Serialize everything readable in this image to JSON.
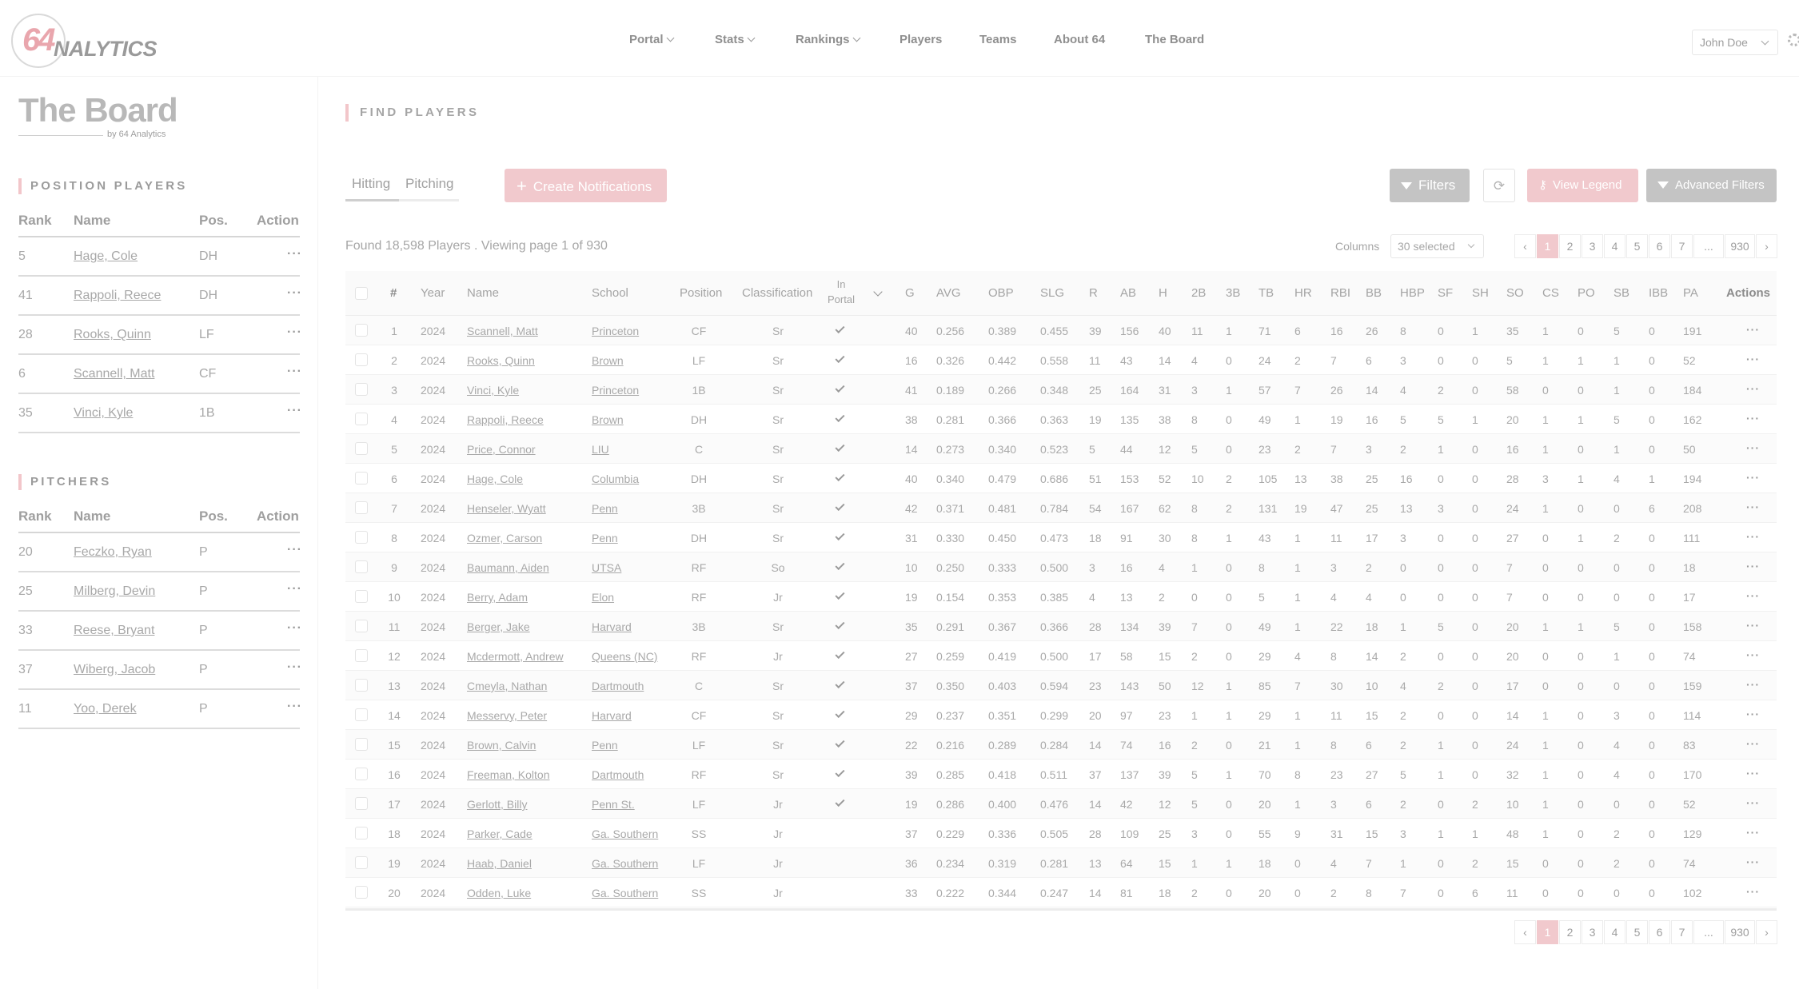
{
  "header": {
    "logo": {
      "num": "64",
      "word": "NALYTICS"
    },
    "nav": [
      {
        "label": "Portal",
        "dropdown": true
      },
      {
        "label": "Stats",
        "dropdown": true
      },
      {
        "label": "Rankings",
        "dropdown": true
      },
      {
        "label": "Players",
        "dropdown": false
      },
      {
        "label": "Teams",
        "dropdown": false
      },
      {
        "label": "About 64",
        "dropdown": false
      },
      {
        "label": "The Board",
        "dropdown": false
      }
    ],
    "user": "John Doe"
  },
  "sidebar": {
    "title": "The Board",
    "subtitle": "by 64 Analytics",
    "position_players": {
      "title": "POSITION PLAYERS",
      "headers": [
        "Rank",
        "Name",
        "Pos.",
        "Action"
      ],
      "rows": [
        {
          "rank": "5",
          "name": "Hage, Cole",
          "pos": "DH"
        },
        {
          "rank": "41",
          "name": "Rappoli, Reece",
          "pos": "DH"
        },
        {
          "rank": "28",
          "name": "Rooks, Quinn",
          "pos": "LF"
        },
        {
          "rank": "6",
          "name": "Scannell, Matt",
          "pos": "CF"
        },
        {
          "rank": "35",
          "name": "Vinci, Kyle",
          "pos": "1B"
        }
      ]
    },
    "pitchers": {
      "title": "PITCHERS",
      "headers": [
        "Rank",
        "Name",
        "Pos.",
        "Action"
      ],
      "rows": [
        {
          "rank": "20",
          "name": "Feczko, Ryan",
          "pos": "P"
        },
        {
          "rank": "25",
          "name": "Milberg, Devin",
          "pos": "P"
        },
        {
          "rank": "33",
          "name": "Reese, Bryant",
          "pos": "P"
        },
        {
          "rank": "37",
          "name": "Wiberg, Jacob",
          "pos": "P"
        },
        {
          "rank": "11",
          "name": "Yoo, Derek",
          "pos": "P"
        }
      ]
    }
  },
  "main": {
    "title": "FIND PLAYERS",
    "tabs": [
      "Hitting",
      "Pitching"
    ],
    "active_tab": "Hitting",
    "buttons": {
      "create": "Create Notifications",
      "filters": "Filters",
      "legend": "View Legend",
      "advanced": "Advanced Filters"
    },
    "found_text": "Found 18,598 Players . Viewing page 1 of 930",
    "columns_label": "Columns",
    "columns_value": "30 selected",
    "pagination": {
      "pages": [
        "1",
        "2",
        "3",
        "4",
        "5",
        "6",
        "7",
        "...",
        "930"
      ],
      "active": "1"
    },
    "table": {
      "headers": [
        "#",
        "Year",
        "Name",
        "School",
        "Position",
        "Classification",
        "In Portal",
        "G",
        "AVG",
        "OBP",
        "SLG",
        "R",
        "AB",
        "H",
        "2B",
        "3B",
        "TB",
        "HR",
        "RBI",
        "BB",
        "HBP",
        "SF",
        "SH",
        "SO",
        "CS",
        "PO",
        "SB",
        "IBB",
        "PA",
        "Actions"
      ],
      "rows": [
        [
          "1",
          "2024",
          "Scannell, Matt",
          "Princeton",
          "CF",
          "Sr",
          true,
          "40",
          "0.256",
          "0.389",
          "0.455",
          "39",
          "156",
          "40",
          "11",
          "1",
          "71",
          "6",
          "16",
          "26",
          "8",
          "0",
          "1",
          "35",
          "1",
          "0",
          "5",
          "0",
          "191"
        ],
        [
          "2",
          "2024",
          "Rooks, Quinn",
          "Brown",
          "LF",
          "Sr",
          true,
          "16",
          "0.326",
          "0.442",
          "0.558",
          "11",
          "43",
          "14",
          "4",
          "0",
          "24",
          "2",
          "7",
          "6",
          "3",
          "0",
          "0",
          "5",
          "1",
          "1",
          "1",
          "0",
          "52"
        ],
        [
          "3",
          "2024",
          "Vinci, Kyle",
          "Princeton",
          "1B",
          "Sr",
          true,
          "41",
          "0.189",
          "0.266",
          "0.348",
          "25",
          "164",
          "31",
          "3",
          "1",
          "57",
          "7",
          "26",
          "14",
          "4",
          "2",
          "0",
          "58",
          "0",
          "0",
          "1",
          "0",
          "184"
        ],
        [
          "4",
          "2024",
          "Rappoli, Reece",
          "Brown",
          "DH",
          "Sr",
          true,
          "38",
          "0.281",
          "0.366",
          "0.363",
          "19",
          "135",
          "38",
          "8",
          "0",
          "49",
          "1",
          "19",
          "16",
          "5",
          "5",
          "1",
          "20",
          "1",
          "1",
          "5",
          "0",
          "162"
        ],
        [
          "5",
          "2024",
          "Price, Connor",
          "LIU",
          "C",
          "Sr",
          true,
          "14",
          "0.273",
          "0.340",
          "0.523",
          "5",
          "44",
          "12",
          "5",
          "0",
          "23",
          "2",
          "7",
          "3",
          "2",
          "1",
          "0",
          "16",
          "1",
          "0",
          "1",
          "0",
          "50"
        ],
        [
          "6",
          "2024",
          "Hage, Cole",
          "Columbia",
          "DH",
          "Sr",
          true,
          "40",
          "0.340",
          "0.479",
          "0.686",
          "51",
          "153",
          "52",
          "10",
          "2",
          "105",
          "13",
          "38",
          "25",
          "16",
          "0",
          "0",
          "28",
          "3",
          "1",
          "4",
          "1",
          "194"
        ],
        [
          "7",
          "2024",
          "Henseler, Wyatt",
          "Penn",
          "3B",
          "Sr",
          true,
          "42",
          "0.371",
          "0.481",
          "0.784",
          "54",
          "167",
          "62",
          "8",
          "2",
          "131",
          "19",
          "47",
          "25",
          "13",
          "3",
          "0",
          "24",
          "1",
          "0",
          "0",
          "6",
          "208"
        ],
        [
          "8",
          "2024",
          "Ozmer, Carson",
          "Penn",
          "DH",
          "Sr",
          true,
          "31",
          "0.330",
          "0.450",
          "0.473",
          "18",
          "91",
          "30",
          "8",
          "1",
          "43",
          "1",
          "11",
          "17",
          "3",
          "0",
          "0",
          "27",
          "0",
          "1",
          "2",
          "0",
          "111"
        ],
        [
          "9",
          "2024",
          "Baumann, Aiden",
          "UTSA",
          "RF",
          "So",
          true,
          "10",
          "0.250",
          "0.333",
          "0.500",
          "3",
          "16",
          "4",
          "1",
          "0",
          "8",
          "1",
          "3",
          "2",
          "0",
          "0",
          "0",
          "7",
          "0",
          "0",
          "0",
          "0",
          "18"
        ],
        [
          "10",
          "2024",
          "Berry, Adam",
          "Elon",
          "RF",
          "Jr",
          true,
          "19",
          "0.154",
          "0.353",
          "0.385",
          "4",
          "13",
          "2",
          "0",
          "0",
          "5",
          "1",
          "4",
          "4",
          "0",
          "0",
          "0",
          "7",
          "0",
          "0",
          "0",
          "0",
          "17"
        ],
        [
          "11",
          "2024",
          "Berger, Jake",
          "Harvard",
          "3B",
          "Sr",
          true,
          "35",
          "0.291",
          "0.367",
          "0.366",
          "28",
          "134",
          "39",
          "7",
          "0",
          "49",
          "1",
          "22",
          "18",
          "1",
          "5",
          "0",
          "20",
          "1",
          "1",
          "5",
          "0",
          "158"
        ],
        [
          "12",
          "2024",
          "Mcdermott, Andrew",
          "Queens (NC)",
          "RF",
          "Jr",
          true,
          "27",
          "0.259",
          "0.419",
          "0.500",
          "17",
          "58",
          "15",
          "2",
          "0",
          "29",
          "4",
          "8",
          "14",
          "2",
          "0",
          "0",
          "20",
          "0",
          "0",
          "1",
          "0",
          "74"
        ],
        [
          "13",
          "2024",
          "Cmeyla, Nathan",
          "Dartmouth",
          "C",
          "Sr",
          true,
          "37",
          "0.350",
          "0.403",
          "0.594",
          "23",
          "143",
          "50",
          "12",
          "1",
          "85",
          "7",
          "30",
          "10",
          "4",
          "2",
          "0",
          "17",
          "0",
          "0",
          "0",
          "0",
          "159"
        ],
        [
          "14",
          "2024",
          "Messervy, Peter",
          "Harvard",
          "CF",
          "Sr",
          true,
          "29",
          "0.237",
          "0.351",
          "0.299",
          "20",
          "97",
          "23",
          "1",
          "1",
          "29",
          "1",
          "11",
          "15",
          "2",
          "0",
          "0",
          "14",
          "1",
          "0",
          "3",
          "0",
          "114"
        ],
        [
          "15",
          "2024",
          "Brown, Calvin",
          "Penn",
          "LF",
          "Sr",
          true,
          "22",
          "0.216",
          "0.289",
          "0.284",
          "14",
          "74",
          "16",
          "2",
          "0",
          "21",
          "1",
          "8",
          "6",
          "2",
          "1",
          "0",
          "24",
          "1",
          "0",
          "4",
          "0",
          "83"
        ],
        [
          "16",
          "2024",
          "Freeman, Kolton",
          "Dartmouth",
          "RF",
          "Sr",
          true,
          "39",
          "0.285",
          "0.418",
          "0.511",
          "37",
          "137",
          "39",
          "5",
          "1",
          "70",
          "8",
          "23",
          "27",
          "5",
          "1",
          "0",
          "32",
          "1",
          "0",
          "4",
          "0",
          "170"
        ],
        [
          "17",
          "2024",
          "Gerlott, Billy",
          "Penn St.",
          "LF",
          "Jr",
          true,
          "19",
          "0.286",
          "0.400",
          "0.476",
          "14",
          "42",
          "12",
          "5",
          "0",
          "20",
          "1",
          "3",
          "6",
          "2",
          "0",
          "2",
          "10",
          "1",
          "0",
          "0",
          "0",
          "52"
        ],
        [
          "18",
          "2024",
          "Parker, Cade",
          "Ga. Southern",
          "SS",
          "Jr",
          false,
          "37",
          "0.229",
          "0.336",
          "0.505",
          "28",
          "109",
          "25",
          "3",
          "0",
          "55",
          "9",
          "31",
          "15",
          "3",
          "1",
          "1",
          "48",
          "1",
          "0",
          "2",
          "0",
          "129"
        ],
        [
          "19",
          "2024",
          "Haab, Daniel",
          "Ga. Southern",
          "LF",
          "Jr",
          false,
          "36",
          "0.234",
          "0.319",
          "0.281",
          "13",
          "64",
          "15",
          "1",
          "1",
          "18",
          "0",
          "4",
          "7",
          "1",
          "0",
          "2",
          "15",
          "0",
          "0",
          "2",
          "0",
          "74"
        ],
        [
          "20",
          "2024",
          "Odden, Luke",
          "Ga. Southern",
          "SS",
          "Jr",
          false,
          "33",
          "0.222",
          "0.344",
          "0.247",
          "14",
          "81",
          "18",
          "2",
          "0",
          "20",
          "0",
          "2",
          "8",
          "7",
          "0",
          "6",
          "11",
          "0",
          "0",
          "0",
          "0",
          "102"
        ]
      ]
    }
  },
  "colors": {
    "accent_pink": "#f1c9cd",
    "button_gray": "#c4c4c4",
    "text_gray": "#a9a9a9"
  }
}
